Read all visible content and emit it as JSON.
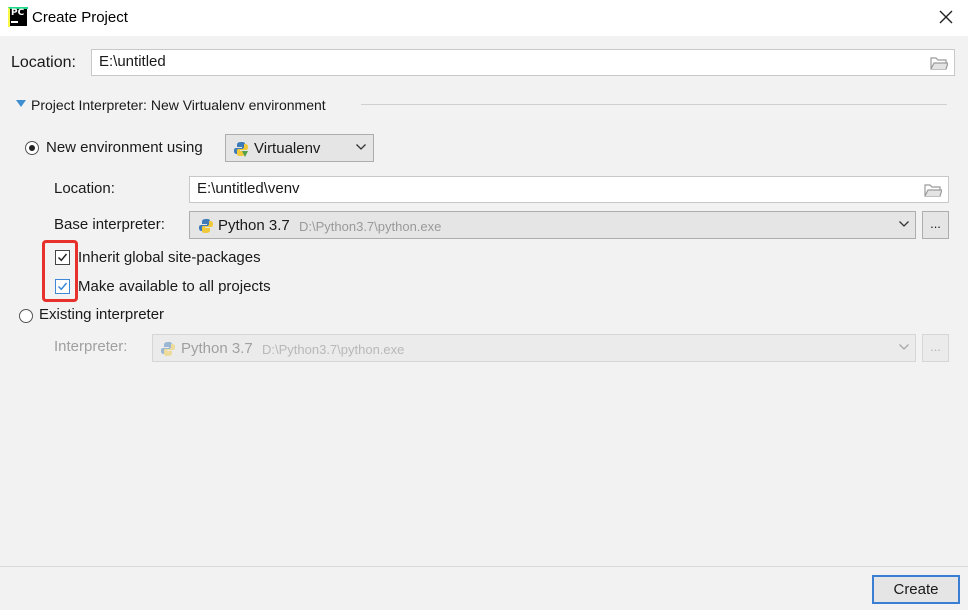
{
  "window": {
    "title": "Create Project",
    "app_icon": "pycharm-icon",
    "app_icon_text": "PC",
    "close_icon": "close-icon"
  },
  "location": {
    "label": "Location:",
    "value": "E:\\untitled",
    "browse_icon": "folder-icon"
  },
  "interpreter_section": {
    "title": "Project Interpreter: New Virtualenv environment",
    "expanded": true,
    "new_env": {
      "label": "New environment using",
      "selected": true,
      "tool": "Virtualenv",
      "location_label": "Location:",
      "location_value": "E:\\untitled\\venv",
      "base_label": "Base interpreter:",
      "base_name": "Python 3.7",
      "base_path": "D:\\Python3.7\\python.exe",
      "browse_label": "...",
      "inherit_label": "Inherit global site-packages",
      "inherit_checked": true,
      "available_label": "Make available to all projects",
      "available_checked": true
    },
    "existing": {
      "label": "Existing interpreter",
      "selected": false,
      "interpreter_label": "Interpreter:",
      "interpreter_name": "Python 3.7",
      "interpreter_path": "D:\\Python3.7\\python.exe",
      "browse_label": "..."
    }
  },
  "footer": {
    "create_label": "Create"
  },
  "colors": {
    "accent": "#3b7fd4",
    "highlight": "#e8312b",
    "checkbox_blue": "#3d88d8"
  }
}
